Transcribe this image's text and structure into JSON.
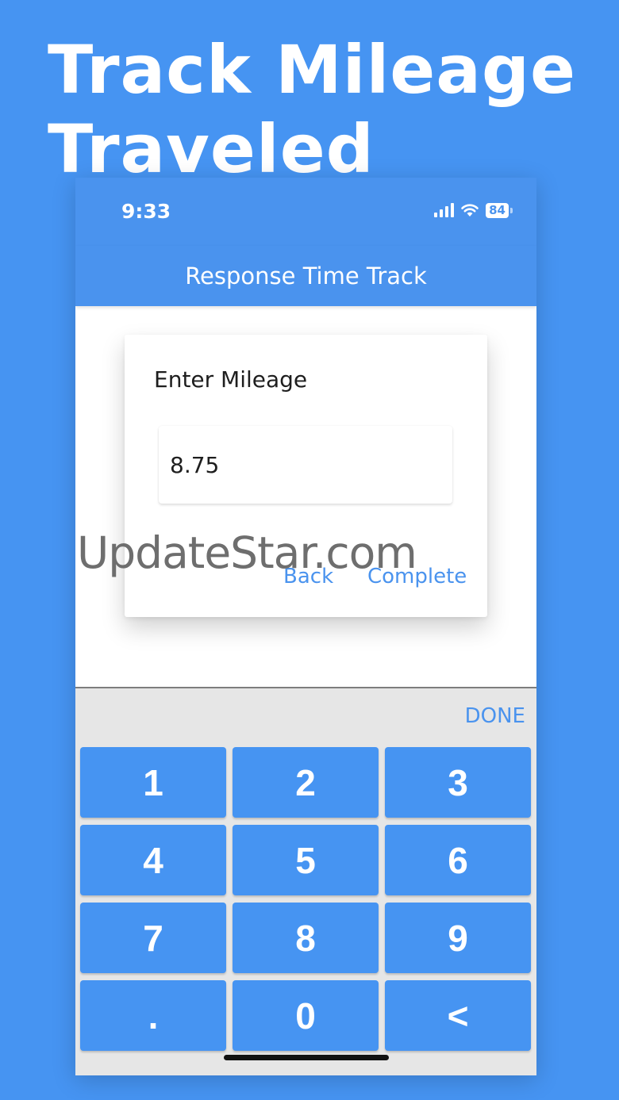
{
  "headline": {
    "line1": "Track Mileage",
    "line2": "Traveled"
  },
  "status_bar": {
    "time": "9:33",
    "battery": "84",
    "icons": [
      "signal-icon",
      "wifi-icon",
      "battery-icon"
    ]
  },
  "app_bar": {
    "title": "Response Time Track"
  },
  "dialog": {
    "title": "Enter Mileage",
    "input_value": "8.75",
    "back_label": "Back",
    "complete_label": "Complete"
  },
  "watermark": "UpdateStar.com",
  "keyboard": {
    "done_label": "DONE",
    "keys": [
      "1",
      "2",
      "3",
      "4",
      "5",
      "6",
      "7",
      "8",
      "9",
      ".",
      "0",
      "<"
    ]
  },
  "colors": {
    "background": "#4694f2",
    "app_bar": "#4a93ee",
    "key": "#4694f2",
    "accent_text": "#4a93ee"
  }
}
